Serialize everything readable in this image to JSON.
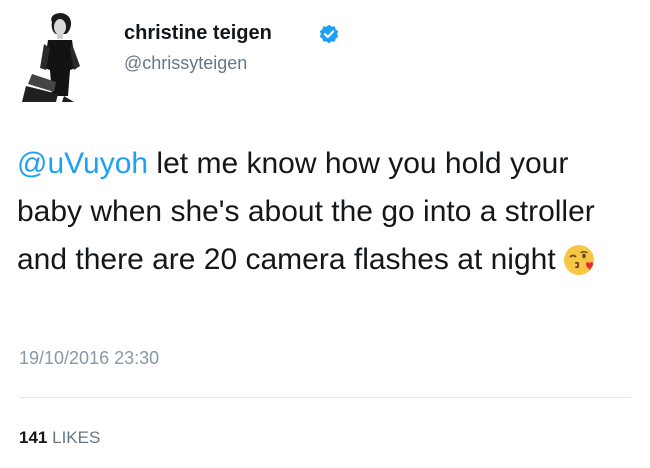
{
  "author": {
    "display_name": "christine teigen",
    "handle": "@chrissyteigen",
    "verified": true,
    "avatar_icon": "profile-photo"
  },
  "tweet": {
    "mention": "@uVuyoh",
    "text": " let me know how you hold your baby when she's about the go into a stroller and there are 20 camera flashes at night",
    "emoji": "face-throwing-kiss",
    "timestamp": "19/10/2016 23:30"
  },
  "stats": {
    "likes_count": "141",
    "likes_label": "LIKES"
  },
  "colors": {
    "link": "#1da1f2",
    "verified_badge": "#1da1f2",
    "text_primary": "#14171a",
    "text_secondary": "#657786",
    "divider": "#e1e8ed"
  }
}
